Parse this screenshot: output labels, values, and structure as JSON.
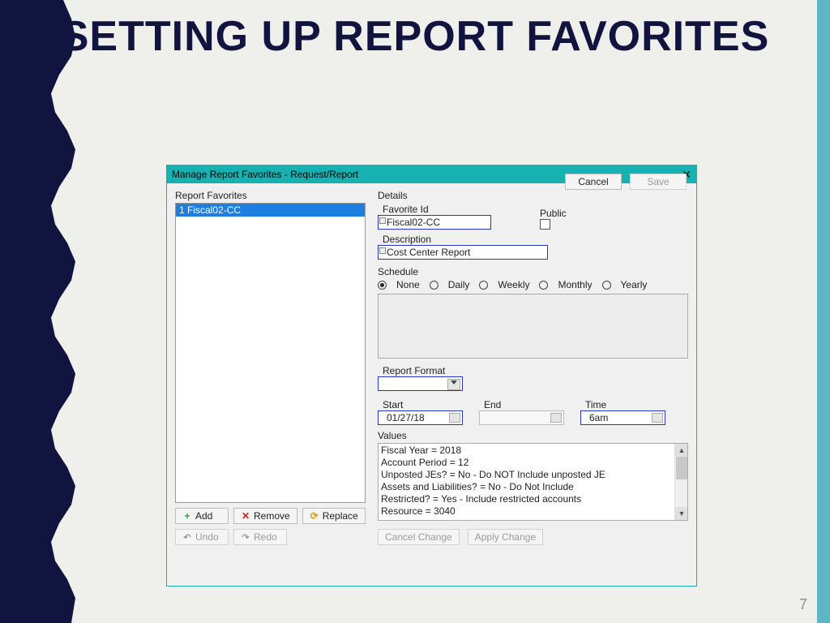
{
  "slide": {
    "title": "SETTING UP REPORT FAVORITES",
    "page_number": "7"
  },
  "dialog": {
    "title": "Manage Report Favorites - Request/Report",
    "report_favorites_label": "Report Favorites",
    "list_item": "1 Fiscal02-CC",
    "buttons": {
      "add": "Add",
      "remove": "Remove",
      "replace": "Replace",
      "undo": "Undo",
      "redo": "Redo",
      "cancel_change": "Cancel Change",
      "apply_change": "Apply Change",
      "cancel": "Cancel",
      "save": "Save"
    },
    "details": {
      "heading": "Details",
      "favorite_id_label": "Favorite Id",
      "favorite_id": "Fiscal02-CC",
      "public_label": "Public",
      "description_label": "Description",
      "description": "Cost Center Report",
      "schedule_label": "Schedule",
      "schedule_options": {
        "none": "None",
        "daily": "Daily",
        "weekly": "Weekly",
        "monthly": "Monthly",
        "yearly": "Yearly"
      },
      "report_format_label": "Report Format",
      "start_label": "Start",
      "start": "01/27/18",
      "end_label": "End",
      "time_label": "Time",
      "time": "6am",
      "values_label": "Values",
      "values_lines": "Fiscal Year = 2018\nAccount Period = 12\nUnposted JEs? = No - Do NOT Include unposted JE\nAssets and Liabilities? = No - Do Not Include\nRestricted? = Yes - Include restricted accounts\nResource = 3040"
    }
  }
}
